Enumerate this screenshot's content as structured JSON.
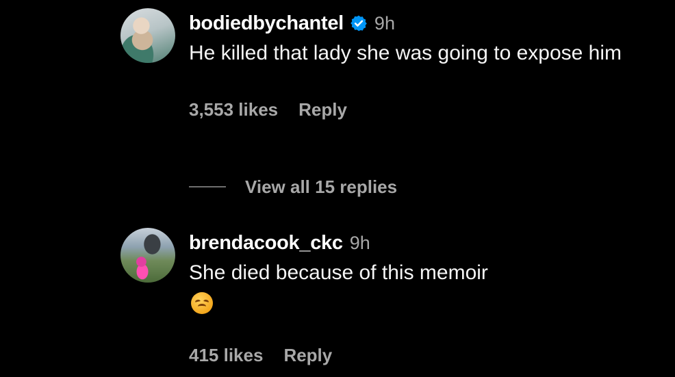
{
  "comments": [
    {
      "username": "bodiedbychantel",
      "verified": true,
      "time": "9h",
      "text": "He killed that lady she was going to expose him",
      "likes": "3,553 likes",
      "reply_label": "Reply",
      "view_replies": "View all 15 replies"
    },
    {
      "username": "brendacook_ckc",
      "verified": false,
      "time": "9h",
      "text": "She died because of this memoir",
      "emoji": "disappointed-face-emoji",
      "likes": "415 likes",
      "reply_label": "Reply"
    }
  ],
  "colors": {
    "background": "#000000",
    "primary_text": "#ffffff",
    "secondary_text": "#a8a8a8",
    "verified_badge": "#0095f6"
  }
}
